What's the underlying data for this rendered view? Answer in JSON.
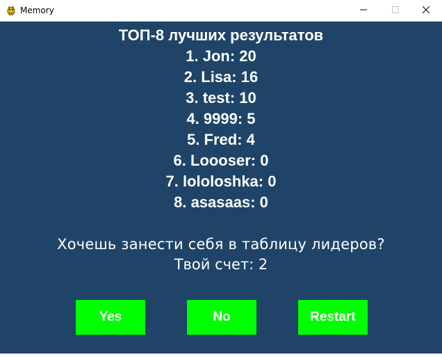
{
  "window": {
    "title": "Memory",
    "app_icon": "pygame-snake-icon",
    "controls": [
      "minimize-icon",
      "maximize-icon",
      "close-icon"
    ]
  },
  "leaderboard": {
    "title": "ТОП-8 лучших результатов",
    "entries": [
      "1. Jon: 20",
      "2. Lisa: 16",
      "3. test: 10",
      "4. 9999: 5",
      "5. Fred: 4",
      "6. Loooser: 0",
      "7. lololoshka: 0",
      "8. asasaas: 0"
    ]
  },
  "prompt": {
    "question": "Хочешь занести себя в таблицу лидеров?",
    "score": "Твой счет: 2"
  },
  "buttons": {
    "yes": "Yes",
    "no": "No",
    "restart": "Restart"
  },
  "colors": {
    "background": "#1f4468",
    "button": "#00ff00",
    "text": "#ffffff"
  }
}
